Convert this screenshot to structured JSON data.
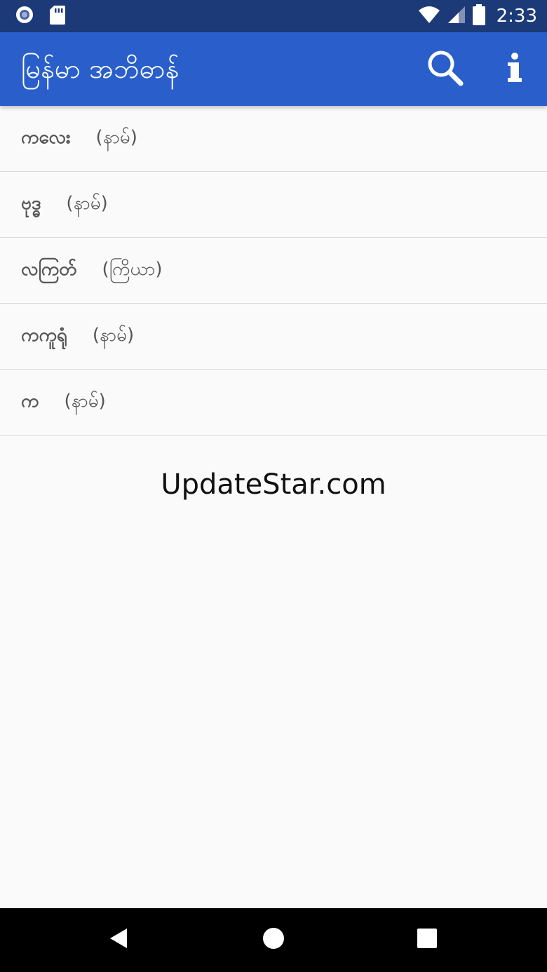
{
  "status_bar": {
    "time": "2:33",
    "icons": [
      "record-icon",
      "sd-card-icon",
      "wifi-icon",
      "signal-icon",
      "battery-icon"
    ]
  },
  "app_bar": {
    "title": "မြန်မာ အဘိဓာန်",
    "actions": [
      "search-icon",
      "info-icon"
    ],
    "color": "#2a5fcb"
  },
  "words": [
    {
      "word": "ကလေး",
      "pos": "(နာမ်)"
    },
    {
      "word": "ဗုဒ္ဓ",
      "pos": "(နာမ်)"
    },
    {
      "word": "လကြတ်",
      "pos": "(ကြိယာ)"
    },
    {
      "word": "ကကူရုံ",
      "pos": "(နာမ်)"
    },
    {
      "word": "က",
      "pos": "(နာမ်)"
    }
  ],
  "footer": {
    "watermark": "UpdateStar.com"
  },
  "nav_bar": {
    "buttons": [
      "back-icon",
      "home-icon",
      "recents-icon"
    ]
  }
}
